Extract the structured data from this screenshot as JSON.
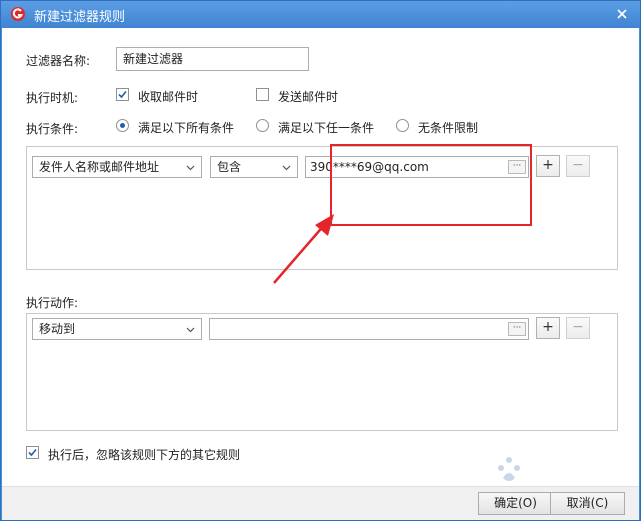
{
  "window": {
    "title": "新建过滤器规则"
  },
  "form": {
    "name_label": "过滤器名称:",
    "name_value": "新建过滤器",
    "timing_label": "执行时机:",
    "timing_options": [
      {
        "label": "收取邮件时",
        "checked": true
      },
      {
        "label": "发送邮件时",
        "checked": false
      }
    ],
    "condition_label": "执行条件:",
    "condition_options": [
      {
        "label": "满足以下所有条件",
        "selected": true
      },
      {
        "label": "满足以下任一条件",
        "selected": false
      },
      {
        "label": "无条件限制",
        "selected": false
      }
    ]
  },
  "condition_row": {
    "field": "发件人名称或邮件地址",
    "operator": "包含",
    "value": "390****69@qq.com",
    "more_label": "···",
    "add_label": "+",
    "remove_label": "−"
  },
  "actions": {
    "label": "执行动作:",
    "action": "移动到",
    "target": "",
    "more_label": "···",
    "add_label": "+",
    "remove_label": "−"
  },
  "options": {
    "ignore_rest_label": "执行后，忽略该规则下方的其它规则",
    "ignore_rest_checked": true
  },
  "buttons": {
    "ok": "确定(O)",
    "cancel": "取消(C)"
  },
  "colors": {
    "titlebar": "#4a8fd9",
    "highlight": "#e4262b",
    "accent": "#1e5fb4"
  }
}
